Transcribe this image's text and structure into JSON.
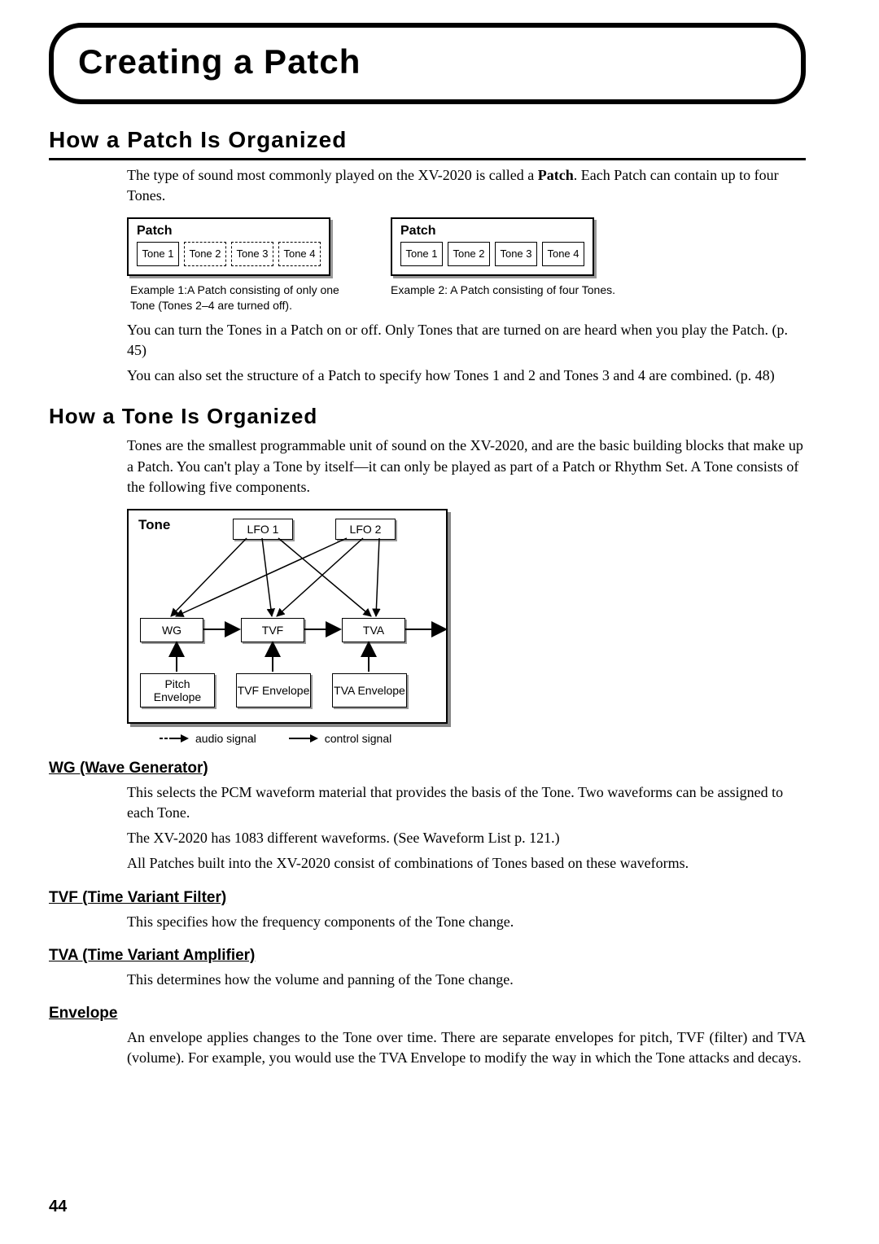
{
  "page_number": "44",
  "title": "Creating a Patch",
  "section1": {
    "heading": "How a Patch Is Organized",
    "intro_a": "The type of sound most commonly played on the XV-2020 is called a ",
    "intro_bold": "Patch",
    "intro_b": ". Each Patch can contain up to four Tones.",
    "example1": "Example 1:A Patch consisting of only one Tone (Tones 2–4 are turned off).",
    "example2": "Example 2: A Patch consisting of four Tones.",
    "para2": "You can turn the Tones in a Patch on or off. Only Tones that are turned on are heard when you play the Patch. (p. 45)",
    "para3": "You can also set the structure of a Patch to specify how Tones 1 and 2 and Tones 3 and 4 are combined. (p. 48)"
  },
  "patch_label": "Patch",
  "tone_labels": [
    "Tone 1",
    "Tone 2",
    "Tone 3",
    "Tone 4"
  ],
  "section2": {
    "heading": "How a Tone Is Organized",
    "para1": "Tones are the smallest programmable unit of sound on the XV-2020, and are the basic building blocks that make up a Patch. You can't play a Tone by itself—it can only be played as part of a Patch or Rhythm Set. A Tone consists of the following five components."
  },
  "tone_diagram": {
    "title": "Tone",
    "lfo1": "LFO 1",
    "lfo2": "LFO 2",
    "wg": "WG",
    "tvf": "TVF",
    "tva": "TVA",
    "pitch_env": "Pitch Envelope",
    "tvf_env": "TVF Envelope",
    "tva_env": "TVA Envelope",
    "legend_audio": "audio signal",
    "legend_control": "control signal"
  },
  "wg": {
    "heading": "WG (Wave Generator)",
    "p1": "This selects the PCM waveform material that provides the basis of the Tone. Two waveforms can be assigned to each Tone.",
    "p2": "The XV-2020 has 1083 different waveforms. (See Waveform List p. 121.)",
    "p3": "All Patches built into the XV-2020 consist of combinations of Tones based on these waveforms."
  },
  "tvf": {
    "heading": "TVF (Time Variant Filter)",
    "p1": "This specifies how the frequency components of the Tone change."
  },
  "tva": {
    "heading": "TVA (Time Variant Amplifier)",
    "p1": "This determines how the volume and panning of the Tone change."
  },
  "env": {
    "heading": "Envelope",
    "p1": "An envelope applies changes to the Tone over time. There are separate envelopes for pitch, TVF (filter) and TVA (volume). For example, you would use the TVA Envelope to modify the way in which the Tone attacks and decays."
  }
}
